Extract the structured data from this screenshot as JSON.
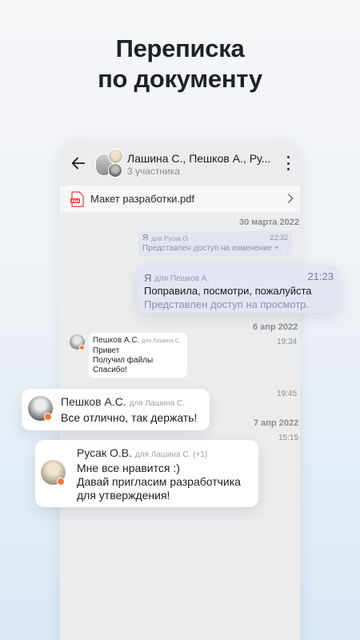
{
  "headline": {
    "line1": "Переписка",
    "line2": "по документу"
  },
  "chat": {
    "title": "Лашина С., Пешков А., Ру...",
    "subtitle": "3 участника"
  },
  "file": {
    "name": "Макет разработки.pdf"
  },
  "messages": {
    "date1": "30 марта 2022",
    "m1": {
      "author": "Я",
      "to": "для Русак О.",
      "time": "22:32",
      "text": "Представлен доступ на изменение +."
    },
    "m2": {
      "author": "Я",
      "to": "для Пешков А.",
      "time": "21:23",
      "text": "Поправила, посмотри, пожалуйста",
      "subtext": "Представлен доступ на просмотр."
    },
    "date2": "6 апр 2022",
    "m3": {
      "author": "Пешков А.С.",
      "to": "для Лашина С.",
      "time": "19:34",
      "text": "Привет\nПолучил файлы\nСпасибо!"
    },
    "m4": {
      "author": "Пешков А.С.",
      "to": "для Лашина С.",
      "time": "19:45",
      "text": "Все отлично, так держать!"
    },
    "date3": "7 апр 2022",
    "m5": {
      "author": "Русак О.В.",
      "to": "для Лашина С. (+1)",
      "time": "15:15",
      "text": "Мне все нравится :)\nДавай пригласим разработчика\nдля утверждения!"
    }
  },
  "colors": {
    "accent_status": "#f07a3a",
    "outgoing_bubble": "#e3e5f4",
    "pdf_red": "#e53935"
  },
  "icons": {
    "back": "arrow-left-icon",
    "more": "more-vertical-icon",
    "file": "pdf-file-icon",
    "chevron": "chevron-right-icon"
  }
}
